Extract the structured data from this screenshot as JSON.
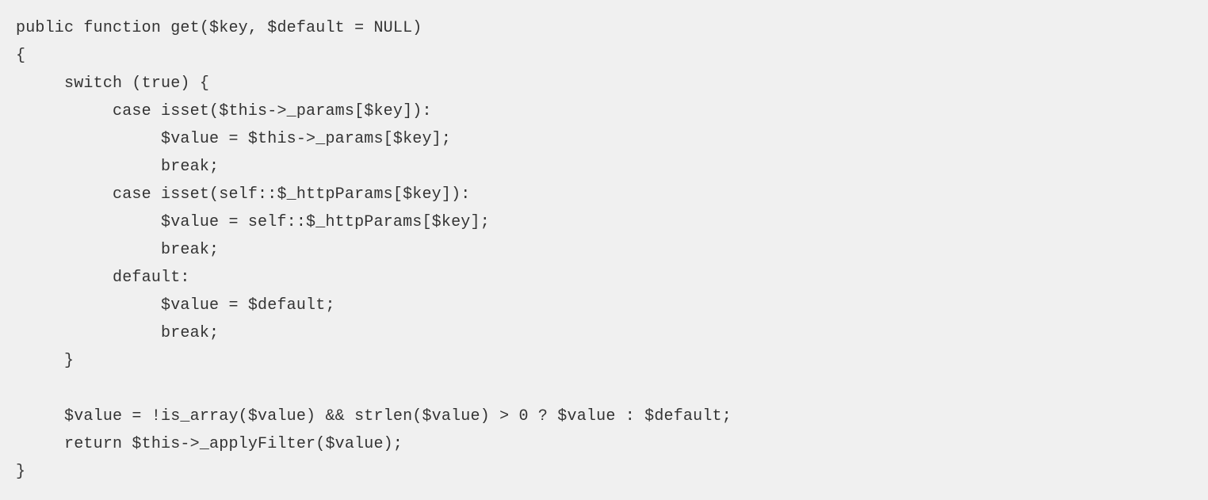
{
  "code": {
    "lines": [
      "public function get($key, $default = NULL)",
      "{",
      "     switch (true) {",
      "          case isset($this->_params[$key]):",
      "               $value = $this->_params[$key];",
      "               break;",
      "          case isset(self::$_httpParams[$key]):",
      "               $value = self::$_httpParams[$key];",
      "               break;",
      "          default:",
      "               $value = $default;",
      "               break;",
      "     }",
      "",
      "     $value = !is_array($value) && strlen($value) > 0 ? $value : $default;",
      "     return $this->_applyFilter($value);",
      "}"
    ]
  }
}
